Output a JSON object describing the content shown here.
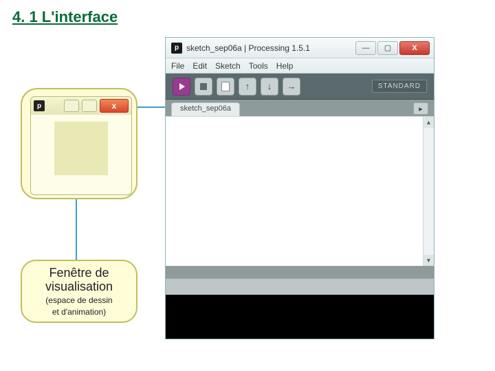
{
  "heading": "4. 1 L'interface",
  "callout": {
    "title_line1": "Fenêtre de",
    "title_line2": "visualisation",
    "sub_line1": "(espace de dessin",
    "sub_line2": "et d'animation)"
  },
  "mini_window": {
    "close_glyph": "x",
    "app_glyph": "p"
  },
  "ide": {
    "app_glyph": "p",
    "title": "sketch_sep06a | Processing 1.5.1",
    "win": {
      "min": "—",
      "max": "▢",
      "close": "X"
    },
    "menu": [
      "File",
      "Edit",
      "Sketch",
      "Tools",
      "Help"
    ],
    "mode_label": "STANDARD",
    "tab_name": "sketch_sep06a",
    "toolbar_icons": {
      "run": "run-icon",
      "stop": "stop-icon",
      "new": "new-icon",
      "open": "open-icon",
      "save": "save-icon",
      "export": "export-icon"
    },
    "scroll": {
      "up": "▲",
      "down": "▼"
    },
    "tab_overflow": "▸"
  }
}
